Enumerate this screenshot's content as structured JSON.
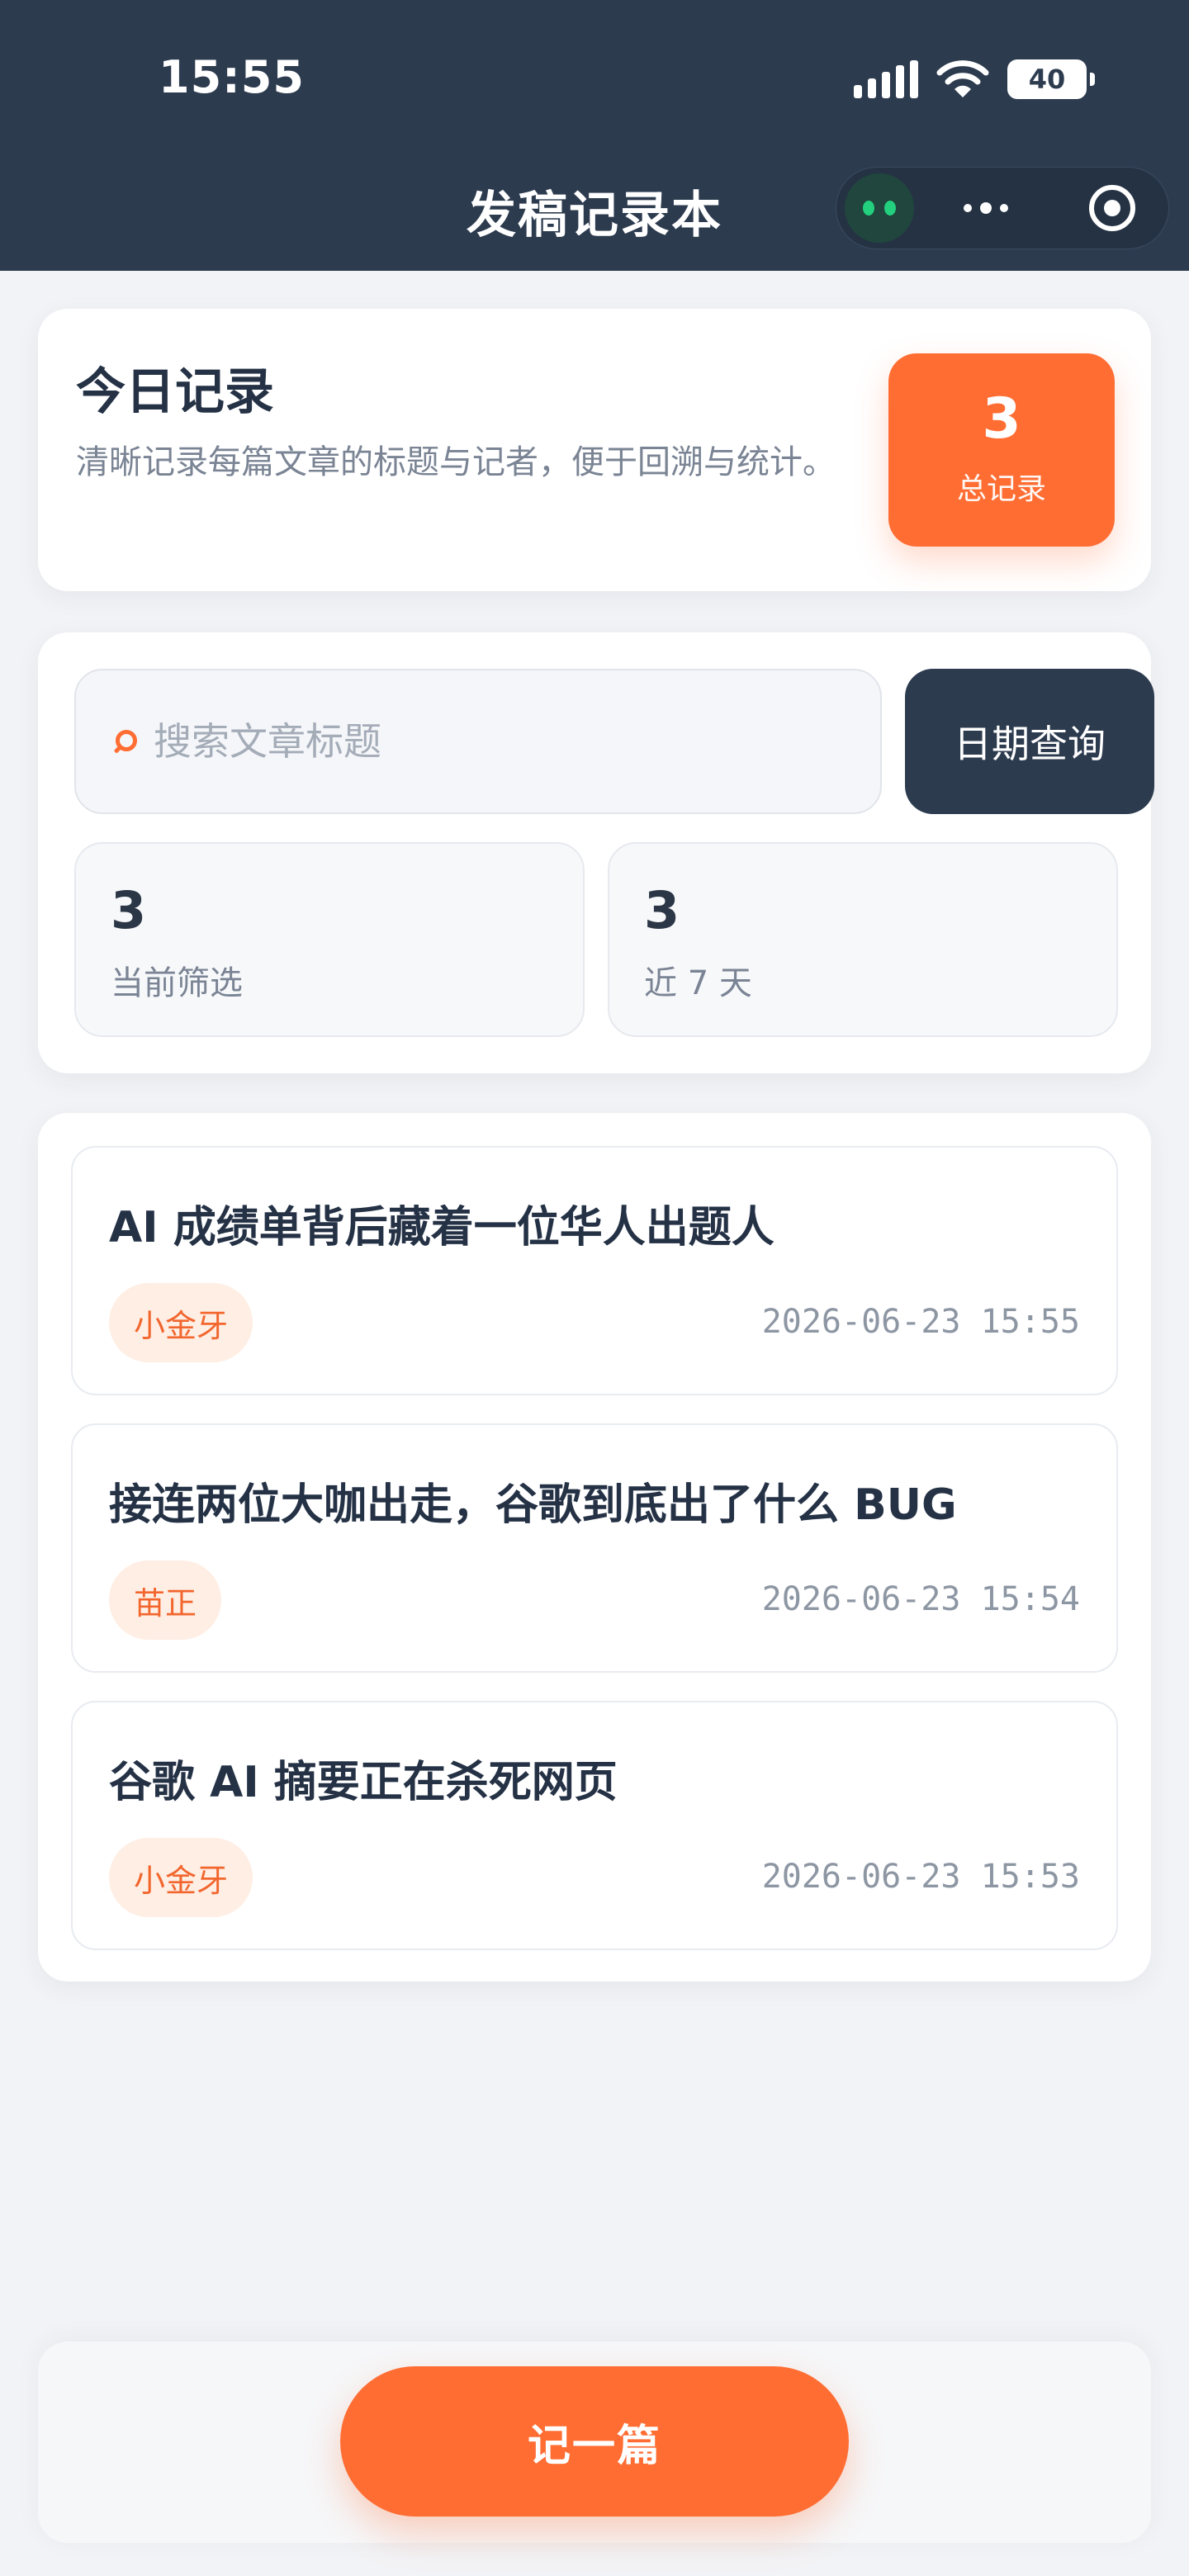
{
  "status_bar": {
    "time": "15:55",
    "battery": "40",
    "icons": [
      "signal-icon",
      "wifi-icon",
      "battery-icon"
    ]
  },
  "nav": {
    "title": "发稿记录本",
    "capsule_icons": [
      "mini-program-eyes-icon",
      "more-dots-icon",
      "close-target-icon"
    ]
  },
  "summary": {
    "title": "今日记录",
    "description": "清晰记录每篇文章的标题与记者，便于回溯与统计。",
    "total_value": "3",
    "total_label": "总记录"
  },
  "filter": {
    "search_placeholder": "搜索文章标题",
    "search_value": "",
    "date_button": "日期查询",
    "stats": [
      {
        "value": "3",
        "label": "当前筛选"
      },
      {
        "value": "3",
        "label": "近 7 天"
      }
    ]
  },
  "records": [
    {
      "title": "AI 成绩单背后藏着一位华人出题人",
      "reporter": "小金牙",
      "time": "2026-06-23 15:55"
    },
    {
      "title": "接连两位大咖出走，谷歌到底出了什么 BUG",
      "reporter": "苗正",
      "time": "2026-06-23 15:54"
    },
    {
      "title": "谷歌 AI 摘要正在杀死网页",
      "reporter": "小金牙",
      "time": "2026-06-23 15:53"
    }
  ],
  "bottom": {
    "record_button": "记一篇"
  },
  "colors": {
    "header_bg": "#2d3b4f",
    "accent": "#ff6d33",
    "page_bg": "#f2f3f6",
    "tag_bg": "#ffeee4"
  }
}
